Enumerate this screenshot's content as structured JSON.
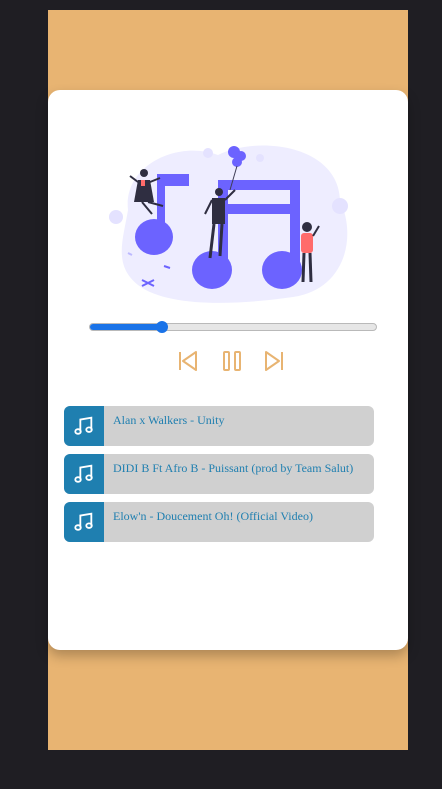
{
  "player": {
    "progress_fraction": 0.25
  },
  "controls": {
    "prev_icon": "skip-previous-icon",
    "pause_icon": "pause-icon",
    "next_icon": "skip-next-icon"
  },
  "playlist": [
    {
      "title": "Alan x Walkers - Unity",
      "icon": "music-note-icon"
    },
    {
      "title": "DIDI B Ft Afro B - Puissant (prod by Team Salut)",
      "icon": "music-note-icon"
    },
    {
      "title": "Elow'n - Doucement Oh! (Official Video)",
      "icon": "music-note-icon"
    }
  ],
  "colors": {
    "background": "#1f1e23",
    "phone": "#e8b472",
    "accent": "#1a73e8",
    "control": "#e8b472",
    "track_bg": "#d0d0d0",
    "track_icon_bg": "#1f7fb0",
    "illustration": "#6c63ff"
  }
}
